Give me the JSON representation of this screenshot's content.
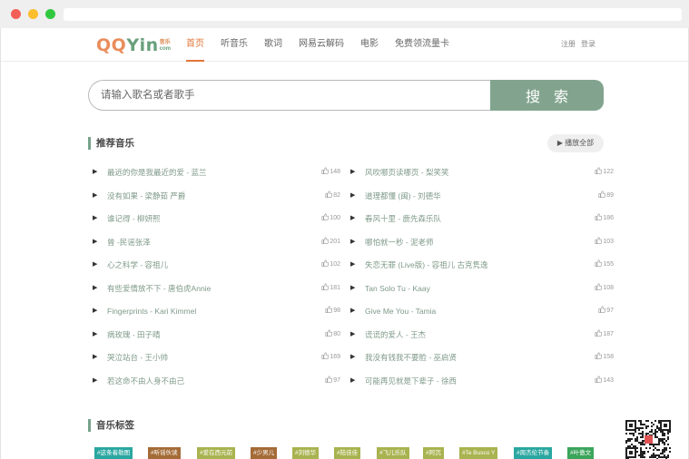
{
  "logo": {
    "main_q": "QQ",
    "main_yin": "Yin",
    "sub_top": "音乐",
    "sub_bottom": "com"
  },
  "nav": [
    {
      "label": "首页",
      "active": true
    },
    {
      "label": "听音乐",
      "active": false
    },
    {
      "label": "歌词",
      "active": false
    },
    {
      "label": "网易云解码",
      "active": false
    },
    {
      "label": "电影",
      "active": false
    },
    {
      "label": "免费领流量卡",
      "active": false
    }
  ],
  "auth": {
    "register": "注册",
    "login": "登录"
  },
  "search": {
    "placeholder": "请输入歌名或者歌手",
    "button": "搜 索"
  },
  "recommend": {
    "title": "推荐音乐",
    "play_all": "▶ 播放全部"
  },
  "songs_left": [
    {
      "name": "最远的你是我最近的爱 - 蓝兰",
      "likes": "148"
    },
    {
      "name": "没有如果 - 梁静茹 严爵",
      "likes": "82"
    },
    {
      "name": "谁记得 - 柳妍熙",
      "likes": "100"
    },
    {
      "name": "曾 -民谣张泽",
      "likes": "201"
    },
    {
      "name": "心之科学 - 容祖儿",
      "likes": "102"
    },
    {
      "name": "有些爱情放不下 - 唐伯虎Annie",
      "likes": "181"
    },
    {
      "name": "Fingerprints - Kari Kimmel",
      "likes": "98"
    },
    {
      "name": "病玫瑰 - 田子晴",
      "likes": "80"
    },
    {
      "name": "哭泣站台 - 王小帅",
      "likes": "169"
    },
    {
      "name": "若这命不由人身不由己",
      "likes": "97"
    }
  ],
  "songs_right": [
    {
      "name": "风吹哪页读哪页 - 梨笑笑",
      "likes": "122"
    },
    {
      "name": "道理都懂 (闽) - 刘德华",
      "likes": "89"
    },
    {
      "name": "春风十里 - 鹿先森乐队",
      "likes": "186"
    },
    {
      "name": "哪怕就一秒 - 泥老师",
      "likes": "103"
    },
    {
      "name": "失恋无罪 (Live版) - 容祖儿 古克隽逸",
      "likes": "155"
    },
    {
      "name": "Tan Solo Tu - Kaay",
      "likes": "108"
    },
    {
      "name": "Give Me You - Tamia",
      "likes": "97"
    },
    {
      "name": "谎谎的爱人 - 王杰",
      "likes": "187"
    },
    {
      "name": "我没有钱我不要脸 - 巫启贤",
      "likes": "158"
    },
    {
      "name": "可能再见就是下辈子 - 徐西",
      "likes": "143"
    }
  ],
  "tags_section": {
    "title": "音乐标签"
  },
  "tags": [
    {
      "label": "#这条着勒图",
      "color": "#2aa7a1"
    },
    {
      "label": "#听谣伙读",
      "color": "#a46b36"
    },
    {
      "label": "#爱在西元前",
      "color": "#a9b34f"
    },
    {
      "label": "#少男儿",
      "color": "#a46b36"
    },
    {
      "label": "#刘德华",
      "color": "#a9b34f"
    },
    {
      "label": "#陆佳佳",
      "color": "#a9b34f"
    },
    {
      "label": "#飞儿乐队",
      "color": "#a9b34f"
    },
    {
      "label": "#阿沉",
      "color": "#a9b34f"
    },
    {
      "label": "#Te Busco Y",
      "color": "#a9b34f"
    },
    {
      "label": "#周杰伦节奏",
      "color": "#2aa7a1"
    },
    {
      "label": "#叶傲文",
      "color": "#3ba55c"
    }
  ],
  "colors": {
    "accent": "#e2763a",
    "brand_green": "#82a48e",
    "song_text": "#7f9a8a"
  },
  "icons": {
    "play": "play-icon",
    "like": "thumb-up-icon",
    "qr": "qr-code-icon"
  }
}
